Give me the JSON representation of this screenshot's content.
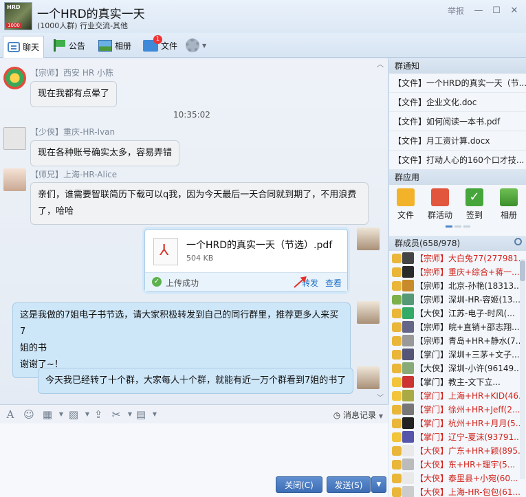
{
  "window": {
    "title": "一个HRD的真实一天",
    "subtitle": "(1000人群) 行业交流-其他",
    "avatar_label": "HRD",
    "avatar_count": "1000",
    "report_label": "举报"
  },
  "toolbar": {
    "chat": "聊天",
    "notice": "公告",
    "album": "相册",
    "files": "文件",
    "files_badge": "1"
  },
  "messages": [
    {
      "sender": "【宗师】西安 HR  小陈",
      "text": "现在我都有点晕了"
    },
    {
      "sender": "【少侠】重庆-HR-Ivan",
      "text": "现在各种账号确实太多，容易弄错"
    },
    {
      "sender": "【师兄】上海-HR-Alice",
      "text_l1": "亲们，谁需要智联简历下载可以q我，因为今天最后一天合同就到期了，不用浪费",
      "text_l2": "了，哈哈"
    }
  ],
  "timestamp": "10:35:02",
  "file_card": {
    "name": "一个HRD的真实一天（节选）.pdf",
    "size": "504 KB",
    "status": "上传成功",
    "forward": "转发",
    "view": "查看"
  },
  "my_messages": {
    "m1_l1": "这是我做的7姐电子书节选，请大家积极转发到自己的同行群里，推荐更多人来买7",
    "m1_l2": "姐的书",
    "m1_l3": "谢谢了~！",
    "m2": "今天我已经转了十个群，大家每人十个群，就能有近一万个群看到7姐的书了"
  },
  "input": {
    "history": "消息记录",
    "close": "关闭(C)",
    "send": "发送(S)"
  },
  "right_panel": {
    "notices_title": "群通知",
    "notices": [
      "【文件】一个HRD的真实一天（节...",
      "【文件】企业文化.doc",
      "【文件】如何阅读一本书.pdf",
      "【文件】月工资计算.docx",
      "【文件】打动人心的160个口才技..."
    ],
    "apps_title": "群应用",
    "apps": [
      "文件",
      "群活动",
      "签到",
      "相册"
    ],
    "members_title": "群成员(658/978)",
    "members": [
      {
        "name": "【宗师】大白兔77(277981...",
        "color": "#d3221b"
      },
      {
        "name": "【宗师】重庆+综合+蒋一...",
        "color": "#d3221b"
      },
      {
        "name": "【宗师】北京-孙艳(18313...",
        "color": "#222222"
      },
      {
        "name": "【宗师】深圳-HR-容姬(13...",
        "color": "#222222"
      },
      {
        "name": "【大侠】江苏-电子-时风(...",
        "color": "#222222"
      },
      {
        "name": "【宗师】皖+直销+邵志翔...",
        "color": "#222222"
      },
      {
        "name": "【宗师】青岛+HR+静水(7...",
        "color": "#222222"
      },
      {
        "name": "【掌门】深圳+三茅+文子...",
        "color": "#222222"
      },
      {
        "name": "【大侠】深圳-小许(96149...",
        "color": "#222222"
      },
      {
        "name": "【掌门】教主-文下立...",
        "color": "#222222"
      },
      {
        "name": "【掌门】上海+HR+KID(46...",
        "color": "#d3221b"
      },
      {
        "name": "【掌门】徐州+HR+Jeff(2...",
        "color": "#d3221b"
      },
      {
        "name": "【掌门】杭州+HR+月月(5...",
        "color": "#d3221b"
      },
      {
        "name": "【掌门】辽宁-夏沫(93791...",
        "color": "#d3221b"
      },
      {
        "name": "【大侠】广东+HR+颖(895...",
        "color": "#d3221b"
      },
      {
        "name": "【大侠】东+HR+理宇(5...",
        "color": "#d3221b"
      },
      {
        "name": "【大侠】泰里县+小宛(60...",
        "color": "#d3221b"
      },
      {
        "name": "【大侠】上海-HR-包包(61...",
        "color": "#d3221b"
      }
    ]
  }
}
